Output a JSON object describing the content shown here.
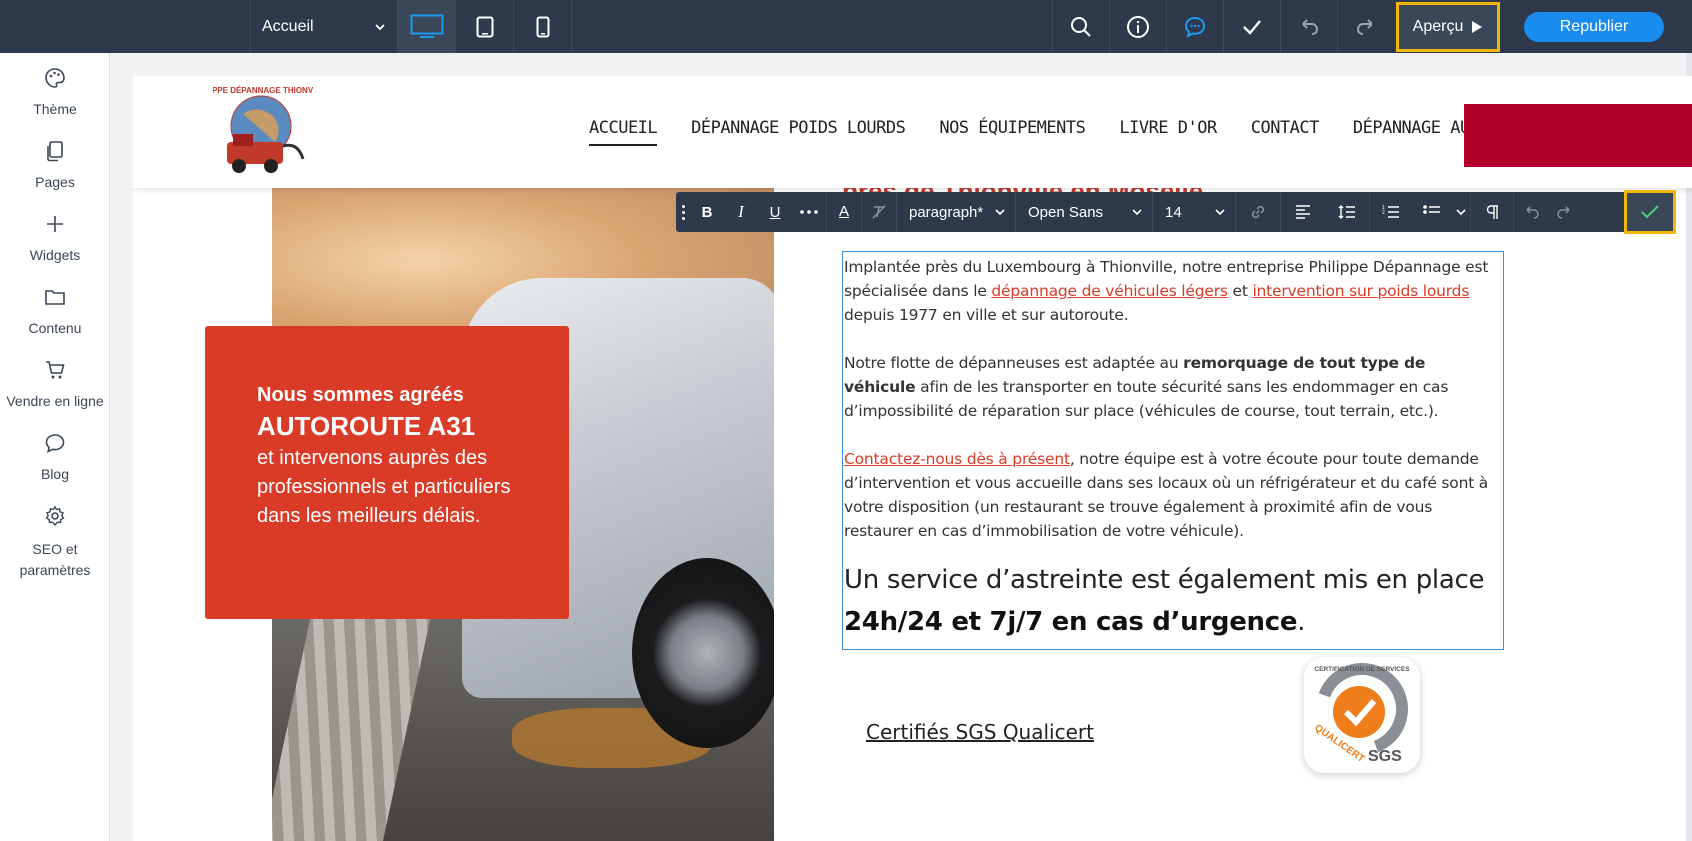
{
  "topbar": {
    "page_select": "Accueil",
    "apercu_label": "Aperçu",
    "republier_label": "Republier",
    "colors": {
      "bar": "#2e3a4b",
      "accent": "#1a8cf0",
      "highlight": "#f2b705",
      "device_active": "#1a9bf0"
    }
  },
  "sidebar": {
    "items": [
      {
        "label": "Thème",
        "icon": "palette-icon"
      },
      {
        "label": "Pages",
        "icon": "pages-icon"
      },
      {
        "label": "Widgets",
        "icon": "plus-icon"
      },
      {
        "label": "Contenu",
        "icon": "folder-icon"
      },
      {
        "label": "Vendre en ligne",
        "icon": "cart-icon"
      },
      {
        "label": "Blog",
        "icon": "chat-bubble-icon"
      },
      {
        "label": "SEO et paramètres",
        "icon": "gear-icon"
      }
    ]
  },
  "site": {
    "nav": [
      "ACCUEIL",
      "DÉPANNAGE POIDS LOURDS",
      "NOS ÉQUIPEMENTS",
      "LIVRE D'OR",
      "CONTACT",
      "DÉPANNAGE AUTO"
    ],
    "logo_text": "PHILIPPE DÉPANNAGE THIONVILLE",
    "heading_peek": "près de Thionville en Moselle",
    "red_box": {
      "line1": "Nous sommes agréés",
      "line2": "AUTOROUTE A31",
      "line3": "et intervenons auprès des professionnels et particuliers dans les meilleurs délais."
    },
    "text": {
      "p1_a": "Implantée près du Luxembourg à Thionville, notre entreprise Philippe Dépannage est spécialisée dans le ",
      "p1_link1": "dépannage de véhicules légers",
      "p1_b": " et ",
      "p1_link2": "intervention sur poids lourds",
      "p1_c": " depuis 1977 en ville et sur autoroute.",
      "p2_a": "Notre flotte de dépanneuses est adaptée au ",
      "p2_bold": "remorquage de tout type de véhicule",
      "p2_b": " afin de les transporter en toute sécurité sans les endommager en cas d’impossibilité de réparation sur place (véhicules de course, tout terrain, etc.).",
      "p3_link": "Contactez-nous dès à présent",
      "p3_a": ", notre équipe est à votre écoute pour toute demande d’intervention et vous accueille dans ses locaux où un réfrigérateur et du café sont à votre disposition (un restaurant se trouve également à proximité afin de vous restaurer en cas d’immobilisation de votre véhicule).",
      "big_a": "Un service d’astreinte est également mis en place ",
      "big_bold": "24h/24 et 7j/7 en cas d’urgence",
      "big_end": "."
    },
    "certif_label": "Certifiés SGS Qualicert",
    "badge": {
      "top": "CERTIFICATION DE SERVICES",
      "left": "QUALICERT",
      "right": "SGS"
    }
  },
  "rte": {
    "bold": "B",
    "italic": "I",
    "underline": "U",
    "text_color": "A",
    "block_format": "paragraph*",
    "font_family": "Open Sans",
    "font_size": "14"
  }
}
